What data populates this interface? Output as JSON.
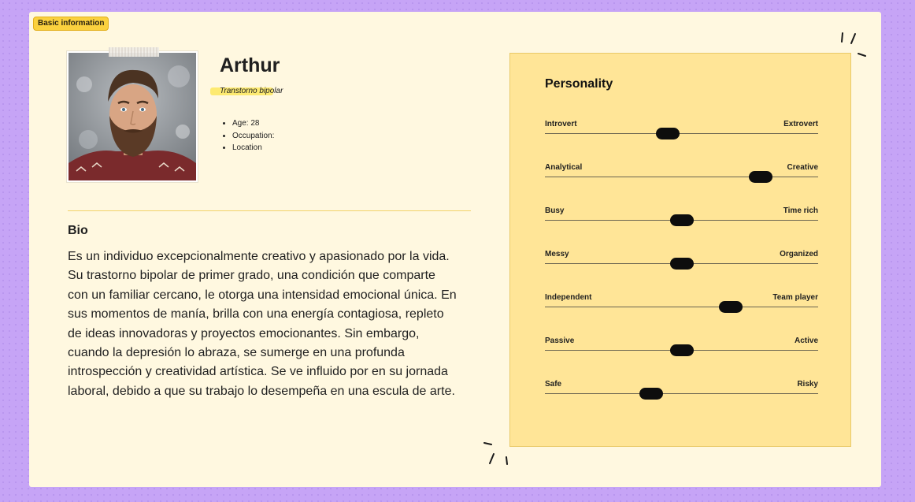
{
  "badge": "Basic information",
  "persona": {
    "name": "Arthur",
    "subtitle": "Transtorno bipolar",
    "facts": [
      "Age: 28",
      "Occupation:",
      "Location"
    ]
  },
  "bio": {
    "title": "Bio",
    "text": "Es un individuo excepcionalmente creativo y apasionado por la vida. Su trastorno bipolar de primer grado, una condición que comparte con un familiar cercano, le otorga una intensidad emocional única. En sus momentos de manía, brilla con una energía contagiosa, repleto de ideas innovadoras y proyectos emocionantes. Sin embargo, cuando la depresión lo abraza, se sumerge en una profunda introspección y creatividad artística. Se ve influido por en su jornada laboral, debido a que su trabajo lo desempeña en una escula de arte."
  },
  "personality": {
    "title": "Personality",
    "traits": [
      {
        "left": "Introvert",
        "right": "Extrovert",
        "value": 0.45
      },
      {
        "left": "Analytical",
        "right": "Creative",
        "value": 0.79
      },
      {
        "left": "Busy",
        "right": "Time rich",
        "value": 0.5
      },
      {
        "left": "Messy",
        "right": "Organized",
        "value": 0.5
      },
      {
        "left": "Independent",
        "right": "Team player",
        "value": 0.68
      },
      {
        "left": "Passive",
        "right": "Active",
        "value": 0.5
      },
      {
        "left": "Safe",
        "right": "Risky",
        "value": 0.39
      }
    ]
  },
  "colors": {
    "background": "#c6a4f6",
    "card": "#fff8e0",
    "panel": "#ffe597",
    "badge": "#fbd13e",
    "highlight": "#fde75d",
    "knob": "#0d0d0d"
  }
}
